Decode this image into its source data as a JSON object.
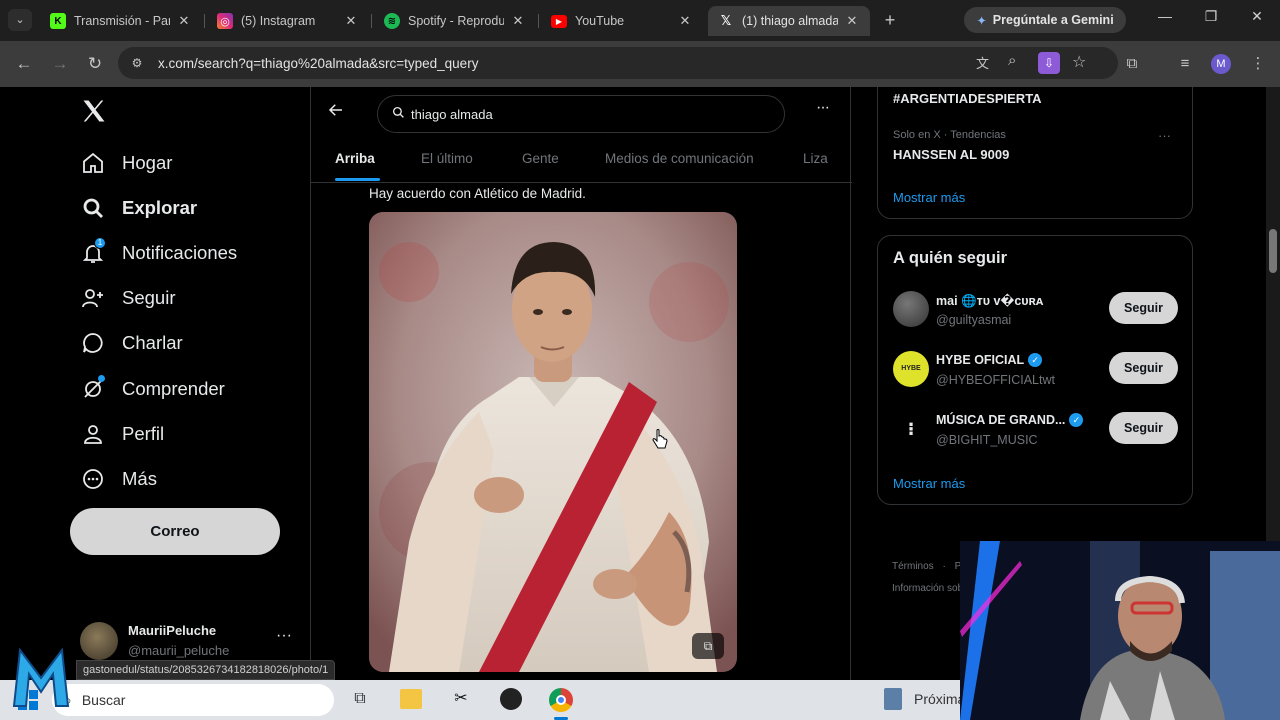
{
  "browser": {
    "tabs": [
      {
        "title": "Transmisión - Pane",
        "icon": "kick-icon",
        "color": "#53fc18",
        "glyph": "K"
      },
      {
        "title": "(5) Instagram",
        "icon": "instagram-icon",
        "color": "#e1306c",
        "glyph": "◎"
      },
      {
        "title": "Spotify - Reproduc",
        "icon": "spotify-icon",
        "color": "#1db954",
        "glyph": "≋"
      },
      {
        "title": "YouTube",
        "icon": "youtube-icon",
        "color": "#ff0000",
        "glyph": "▶"
      },
      {
        "title": "(1) thiago almada",
        "icon": "x-icon",
        "color": "#000000",
        "glyph": "𝕏"
      }
    ],
    "gemini_label": "Pregúntale a Gemini",
    "url": "x.com/search?q=thiago%20almada&src=typed_query",
    "status_url": "gastonedul/status/2085326734182818026/photo/1"
  },
  "nav": {
    "items": [
      {
        "label": "Hogar",
        "icon": "home-icon"
      },
      {
        "label": "Explorar",
        "icon": "search-icon"
      },
      {
        "label": "Notificaciones",
        "icon": "bell-icon"
      },
      {
        "label": "Seguir",
        "icon": "person-add-icon"
      },
      {
        "label": "Charlar",
        "icon": "chat-icon"
      },
      {
        "label": "Comprender",
        "icon": "grok-icon"
      },
      {
        "label": "Perfil",
        "icon": "person-icon"
      },
      {
        "label": "Más",
        "icon": "more-circle-icon"
      }
    ],
    "post_button": "Correo",
    "account": {
      "name": "MauriiPeluche",
      "handle": "@maurii_peluche"
    }
  },
  "search": {
    "query": "thiago almada",
    "tabs": [
      "Arriba",
      "El último",
      "Gente",
      "Medios de comunicación",
      "Liza"
    ],
    "active_tab": "Arriba"
  },
  "post": {
    "text": "Hay acuerdo con Atlético de Madrid."
  },
  "trends": {
    "top_item": "#ARGENTIADESPIERTA",
    "item_meta": "Solo en X · Tendencias",
    "item_title": "HANSSEN AL 9009",
    "show_more": "Mostrar más"
  },
  "who_to_follow": {
    "title": "A quién seguir",
    "accounts": [
      {
        "name": "mai 🌐ᴛᴜ ᴠ�ᴄᴜʀᴀ",
        "handle": "@guiltyasmai",
        "verified": false,
        "button": "Seguir"
      },
      {
        "name": "HYBE OFICIAL",
        "handle": "@HYBEOFFICIALtwt",
        "verified": true,
        "button": "Seguir"
      },
      {
        "name": "MÚSICA DE GRAND...",
        "handle": "@BIGHIT_MUSIC",
        "verified": true,
        "button": "Seguir"
      }
    ],
    "show_more": "Mostrar más"
  },
  "footer": {
    "links": [
      "Términos",
      "Pr",
      "Información sob"
    ]
  },
  "taskbar": {
    "search_placeholder": "Buscar",
    "widget_text": "Próxima"
  },
  "colors": {
    "accent": "#1d9bf0",
    "verified": "#1d9bf0",
    "hybe_avatar": "#dfe22b"
  }
}
